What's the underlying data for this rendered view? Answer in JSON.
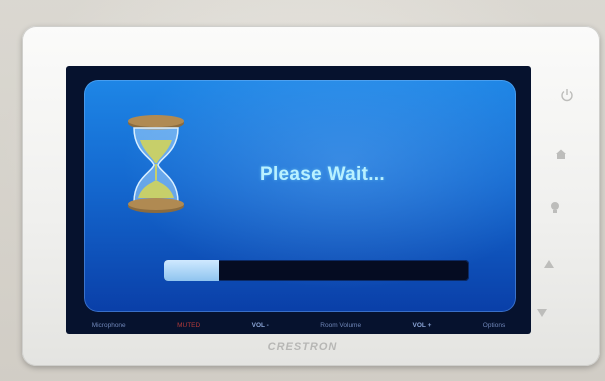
{
  "screen": {
    "title": "Please Wait...",
    "progress_fraction": 0.18
  },
  "footer": {
    "items": [
      "Microphone",
      "MUTED",
      "VOL -",
      "Room Volume",
      "VOL +",
      "Options"
    ]
  },
  "hardware_buttons": [
    "power-icon",
    "home-icon",
    "light-bulb-icon",
    "up-arrow-icon",
    "down-arrow-icon"
  ],
  "brand": "CRESTRON",
  "colors": {
    "panel_blue": "#1468cf",
    "title_cyan": "#b9f1ff",
    "progress_fill": "#8fc4ef",
    "muted_red": "#b33a3a"
  }
}
